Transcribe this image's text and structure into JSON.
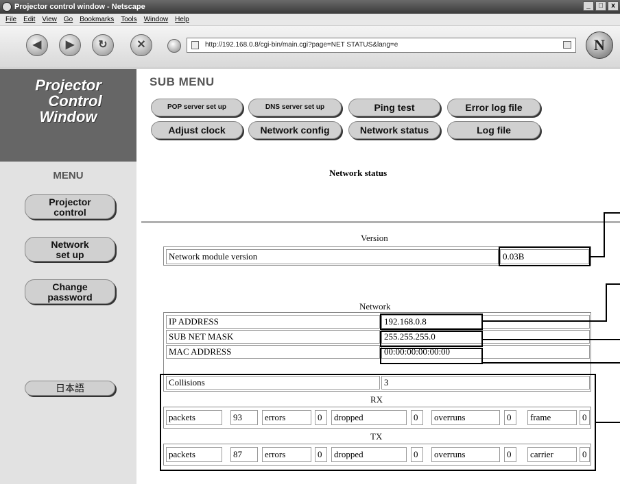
{
  "window": {
    "title": "Projector control window - Netscape",
    "controls": [
      "_",
      "□",
      "x"
    ]
  },
  "menubar": [
    "File",
    "Edit",
    "View",
    "Go",
    "Bookmarks",
    "Tools",
    "Window",
    "Help"
  ],
  "toolbar": {
    "url": "http://192.168.0.8/cgi-bin/main.cgi?page=NET STATUS&lang=e",
    "back_icon": "back-arrow-icon",
    "forward_icon": "forward-arrow-icon",
    "reload_icon": "reload-icon",
    "stop_icon": "stop-icon",
    "logo": "N"
  },
  "brand": {
    "line1": "Projector",
    "line2": "Control",
    "line3": "Window"
  },
  "submenu": {
    "title": "SUB MENU",
    "buttons": [
      "POP server set up",
      "DNS server set up",
      "Ping test",
      "Error log file",
      "Adjust clock",
      "Network config",
      "Network status",
      "Log file"
    ]
  },
  "menu": {
    "title": "MENU",
    "projector_control": [
      "Projector",
      "control"
    ],
    "network_setup": [
      "Network",
      "set up"
    ],
    "change_password": [
      "Change",
      "password"
    ],
    "language": "日本語"
  },
  "page": {
    "heading": "Network status",
    "version_section": "Version",
    "version_label": "Network module version",
    "version_value": "0.03B",
    "network_section": "Network",
    "network_rows": [
      {
        "label": "IP ADDRESS",
        "value": "192.168.0.8"
      },
      {
        "label": "SUB NET MASK",
        "value": "255.255.255.0"
      },
      {
        "label": "MAC ADDRESS",
        "value": "00:00:00:00:00:00"
      },
      {
        "label": "Collisions",
        "value": "3"
      }
    ],
    "rx_title": "RX",
    "rx": [
      {
        "label": "packets",
        "value": "93"
      },
      {
        "label": "errors",
        "value": "0"
      },
      {
        "label": "dropped",
        "value": "0"
      },
      {
        "label": "overruns",
        "value": "0"
      },
      {
        "label": "frame",
        "value": "0"
      }
    ],
    "tx_title": "TX",
    "tx": [
      {
        "label": "packets",
        "value": "87"
      },
      {
        "label": "errors",
        "value": "0"
      },
      {
        "label": "dropped",
        "value": "0"
      },
      {
        "label": "overruns",
        "value": "0"
      },
      {
        "label": "carrier",
        "value": "0"
      }
    ]
  }
}
